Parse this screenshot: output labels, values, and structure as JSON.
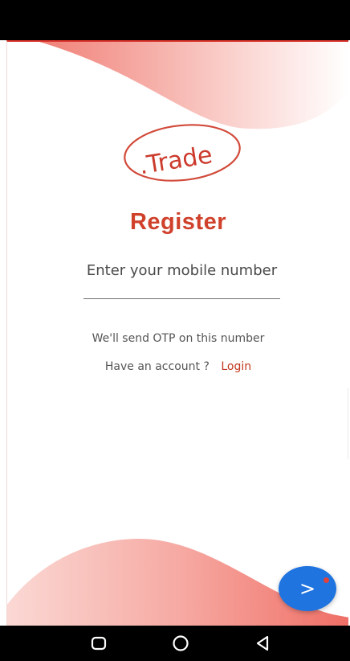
{
  "brand": {
    "logo_text": ".Trade",
    "accent_color": "#d0412b"
  },
  "register": {
    "title": "Register",
    "mobile_placeholder": "Enter your mobile number",
    "mobile_value": "",
    "otp_hint": "We'll send OTP on this number",
    "have_account_text": "Have an account ?",
    "login_label": "Login"
  },
  "actions": {
    "next_symbol": ">",
    "next_color": "#1f74e0"
  },
  "nav": {
    "icons": [
      "recent-apps-icon",
      "home-icon",
      "back-icon"
    ]
  }
}
